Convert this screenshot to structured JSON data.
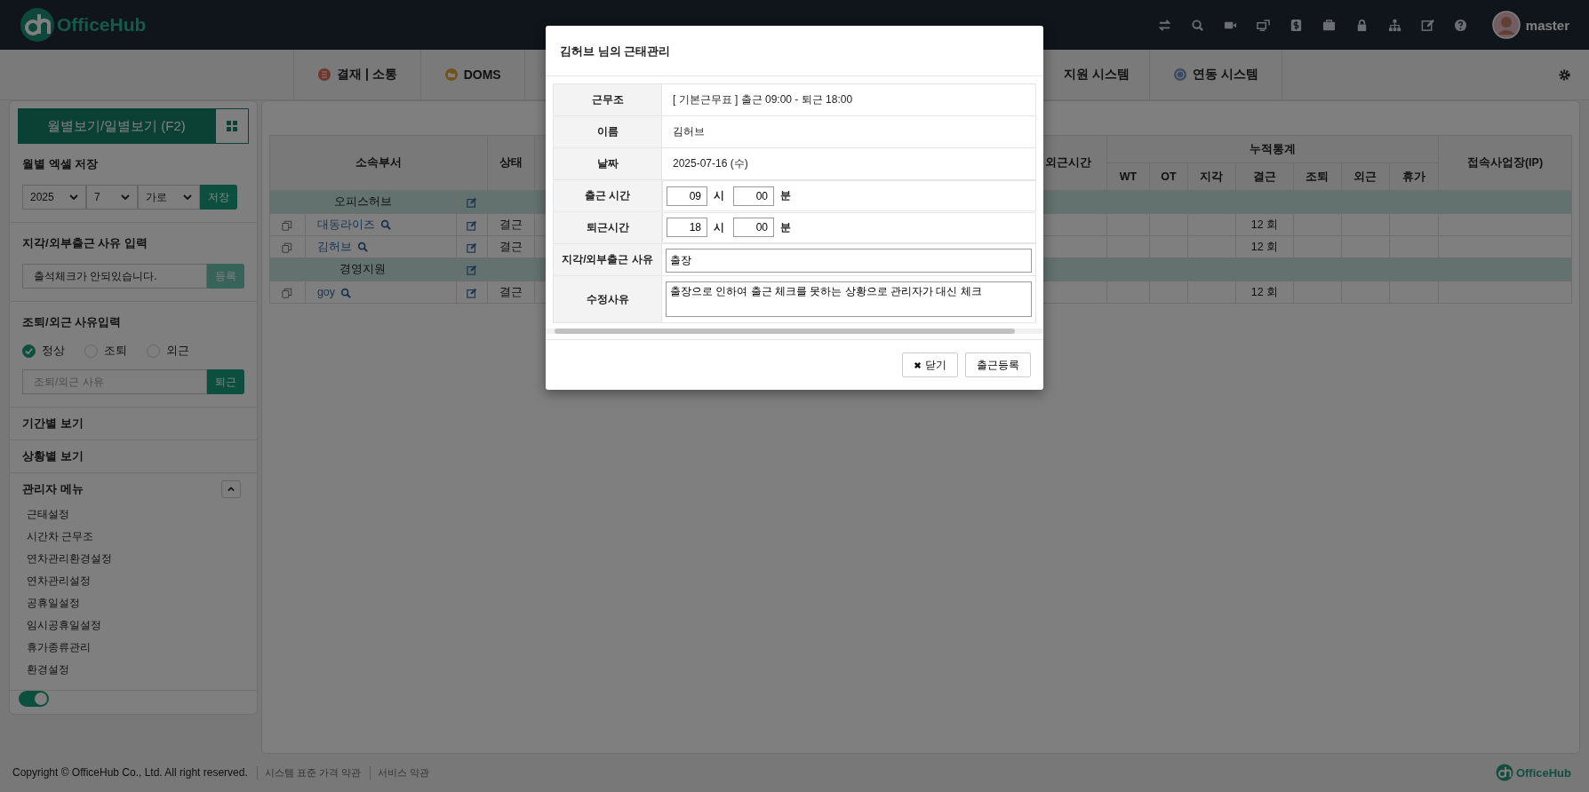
{
  "header": {
    "logo": "OfficeHub",
    "user": "master"
  },
  "nav": {
    "items": [
      {
        "label": "결재 | 소통",
        "kind": "approval"
      },
      {
        "label": "DOMS",
        "kind": "doms"
      },
      {
        "label": "지원 시스템",
        "kind": "plain"
      },
      {
        "label": "연동 시스템",
        "kind": "link"
      }
    ]
  },
  "sidebar": {
    "view_toggle": "월별보기/일별보기 (F2)",
    "excel": {
      "title": "월별 엑셀 저장",
      "selects": [
        "2025",
        "7",
        "가로"
      ],
      "button": "저장"
    },
    "late": {
      "title": "지각/외부출근 사유 입력",
      "value": "출석체크가 안되있습니다.",
      "button": "등록",
      "button_disabled": true
    },
    "early": {
      "title": "조퇴/외근 사유입력",
      "options": [
        {
          "label": "정상",
          "selected": true
        },
        {
          "label": "조퇴",
          "selected": false
        },
        {
          "label": "외근",
          "selected": false
        }
      ],
      "placeholder": "조퇴/외근 사유",
      "button": "퇴근"
    },
    "links": [
      "기간별 보기",
      "상황별 보기"
    ],
    "admin": {
      "title": "관리자 메뉴",
      "expanded": true,
      "items": [
        "근태설정",
        "시간차 근무조",
        "연차관리환경설정",
        "연차관리설정",
        "공휴일설정",
        "임시공휴일설정",
        "휴가종류관리",
        "환경설정"
      ]
    },
    "switch": {
      "on": true
    }
  },
  "table": {
    "columns": {
      "dept": "소속부서",
      "status": "상태",
      "out_time": "외근시간",
      "stats": "누적통계",
      "stat_columns": [
        "WT",
        "OT",
        "지각",
        "결근",
        "조퇴",
        "외근",
        "휴가"
      ],
      "ip": "접속사업장(IP)"
    },
    "rows": [
      {
        "kind": "group",
        "name": "오피스허브"
      },
      {
        "kind": "person",
        "name": "대동라이즈",
        "status": "결근",
        "absent": "12 회"
      },
      {
        "kind": "person",
        "name": "김허브",
        "status": "결근",
        "absent": "12 회"
      },
      {
        "kind": "group",
        "name": "경영지원"
      },
      {
        "kind": "person",
        "name": "goy",
        "status": "결근",
        "absent": "12 회"
      }
    ]
  },
  "modal": {
    "title": "김허브 님의 근태관리",
    "fields": [
      {
        "label": "근무조",
        "kind": "text",
        "value": "[ 기본근무표 ] 출근 09:00 - 퇴근 18:00"
      },
      {
        "label": "이름",
        "kind": "text",
        "value": "김허브"
      },
      {
        "label": "날짜",
        "kind": "text",
        "value": "2025-07-16 (수)"
      },
      {
        "label": "출근 시간",
        "kind": "time",
        "hour": "09",
        "hour_unit": "시",
        "minute": "00",
        "minute_unit": "분"
      },
      {
        "label": "퇴근시간",
        "kind": "time",
        "hour": "18",
        "hour_unit": "시",
        "minute": "00",
        "minute_unit": "분"
      },
      {
        "label": "지각/외부출근 사유",
        "kind": "input",
        "value": "출장"
      },
      {
        "label": "수정사유",
        "kind": "textarea",
        "value": "출장으로 인하여 출근 체크를 못하는 상황으로 관리자가 대신 체크"
      }
    ],
    "buttons": [
      {
        "label": "닫기",
        "kind": "close"
      },
      {
        "label": "출근등록",
        "kind": "plain"
      }
    ]
  },
  "footer": {
    "copyright": "Copyright © OfficeHub Co., Ltd. All right reserved.",
    "links": [
      "시스템 표준 가격 약관",
      "서비스 약관"
    ],
    "logo": "OfficeHub"
  }
}
